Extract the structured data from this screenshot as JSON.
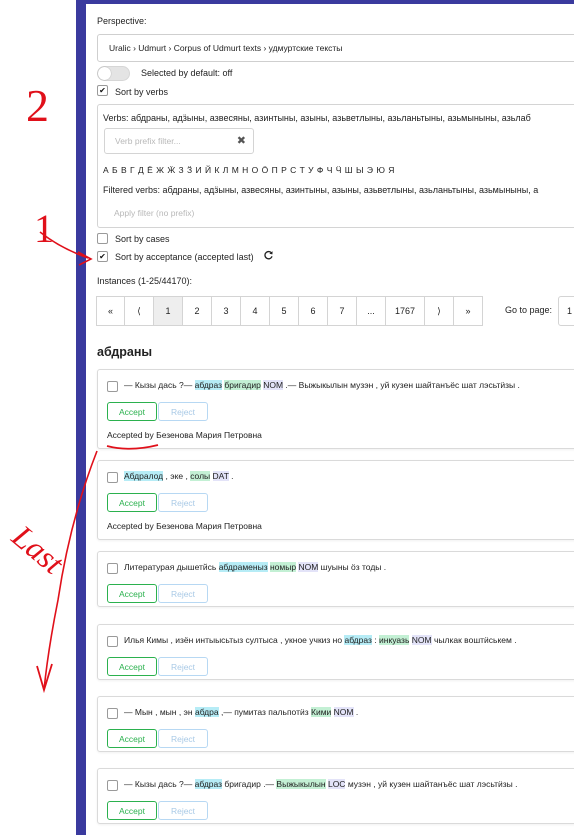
{
  "perspective": {
    "label": "Perspective:",
    "value": "Uralic › Udmurt › Corpus of Udmurt texts › удмуртские тексты"
  },
  "selected_by_default": {
    "label": "Selected by default: off",
    "on": false
  },
  "sort_by_verbs": {
    "label": "Sort by verbs",
    "checked": true
  },
  "verbs_panel": {
    "verbs_line": "Verbs: абдраны, адӟыны, азвесяны, азинтыны, азыны, азьветлыны, азьланьтыны, азьмыныны, азьлаб",
    "prefix_placeholder": "Verb prefix filter...",
    "clear_icon": "✖",
    "alphabet": "А Б В Г Д Ё Ж Ӝ З Ӟ И Й К Л М Н О Ӧ П Р С Т У Ф Ч Ӵ Ш Ы Э Ю Я",
    "filtered_line": "Filtered verbs: абдраны, адӟыны, азвесяны, азинтыны, азыны, азьветлыны, азьланьтыны, азьмыныны, а",
    "apply_label": "Apply filter (no prefix)"
  },
  "sort_by_cases": {
    "label": "Sort by cases",
    "checked": false
  },
  "sort_by_acceptance": {
    "label": "Sort by acceptance (accepted last)",
    "checked": true,
    "icon": "refresh-icon"
  },
  "instances_label": "Instances (1-25/44170):",
  "pagination": {
    "items": [
      "«",
      "⟨",
      "1",
      "2",
      "3",
      "4",
      "5",
      "6",
      "7",
      "...",
      "1767",
      "⟩",
      "»"
    ],
    "active": "1",
    "goto_label": "Go to page:",
    "goto_value": "1"
  },
  "word_heading": "абдраны",
  "buttons": {
    "accept": "Accept",
    "reject": "Reject"
  },
  "instances": [
    {
      "segments": [
        {
          "t": "— Кызы дась ?— ",
          "h": ""
        },
        {
          "t": "абдраз",
          "h": "c"
        },
        {
          "t": " ",
          "h": ""
        },
        {
          "t": "бригадир",
          "h": "g"
        },
        {
          "t": " ",
          "h": ""
        },
        {
          "t": "NOM",
          "h": "p"
        },
        {
          "t": " .— Выжыкылын музэн , уй кузен шайтанъёс шат лэсьтӥзы .",
          "h": ""
        }
      ],
      "accepted_by": "Accepted by Безенова Мария Петровна"
    },
    {
      "segments": [
        {
          "t": "Абдралод",
          "h": "c"
        },
        {
          "t": " , эке , ",
          "h": ""
        },
        {
          "t": "солы",
          "h": "g"
        },
        {
          "t": " ",
          "h": ""
        },
        {
          "t": "DAT",
          "h": "p"
        },
        {
          "t": " .",
          "h": ""
        }
      ],
      "accepted_by": "Accepted by Безенова Мария Петровна"
    },
    {
      "segments": [
        {
          "t": "Литературая дышетйсь ",
          "h": ""
        },
        {
          "t": "абдраменыз",
          "h": "c"
        },
        {
          "t": " ",
          "h": ""
        },
        {
          "t": "номыр",
          "h": "g"
        },
        {
          "t": " ",
          "h": ""
        },
        {
          "t": "NOM",
          "h": "p"
        },
        {
          "t": " шуыны ӧз тоды .",
          "h": ""
        }
      ],
      "accepted_by": ""
    },
    {
      "segments": [
        {
          "t": "Илья Кимы , изён интыысьтыз султыса , укное учкиз но ",
          "h": ""
        },
        {
          "t": "абдраз",
          "h": "c"
        },
        {
          "t": " : ",
          "h": ""
        },
        {
          "t": "инкуазь",
          "h": "g"
        },
        {
          "t": " ",
          "h": ""
        },
        {
          "t": "NOM",
          "h": "p"
        },
        {
          "t": " чылкак воштӥськем .",
          "h": ""
        }
      ],
      "accepted_by": ""
    },
    {
      "segments": [
        {
          "t": "— Мын , мын , эн ",
          "h": ""
        },
        {
          "t": "абдра",
          "h": "c"
        },
        {
          "t": " ,— пумитаз пальпотӥз ",
          "h": ""
        },
        {
          "t": "Кими",
          "h": "g"
        },
        {
          "t": " ",
          "h": ""
        },
        {
          "t": "NOM",
          "h": "p"
        },
        {
          "t": " .",
          "h": ""
        }
      ],
      "accepted_by": ""
    },
    {
      "segments": [
        {
          "t": "— Кызы дась ?— ",
          "h": ""
        },
        {
          "t": "абдраз",
          "h": "c"
        },
        {
          "t": " бригадир .— ",
          "h": ""
        },
        {
          "t": "Выжыкылын",
          "h": "g"
        },
        {
          "t": " ",
          "h": ""
        },
        {
          "t": "LOC",
          "h": "p"
        },
        {
          "t": " музэн , уй кузен шайтанъёс шат лэсьтӥзы .",
          "h": ""
        }
      ],
      "accepted_by": ""
    }
  ],
  "annotations": {
    "one": "1",
    "two": "2",
    "last": "Last"
  },
  "colors": {
    "sidebar": "#3a3a9e",
    "accept": "#2bb14e",
    "reject": "#a8c9e6",
    "highlight_cyan": "#b6ecf6",
    "highlight_green": "#c3f0d4",
    "highlight_lavender": "#e3e3f8",
    "annotation_red": "#e0101a"
  }
}
